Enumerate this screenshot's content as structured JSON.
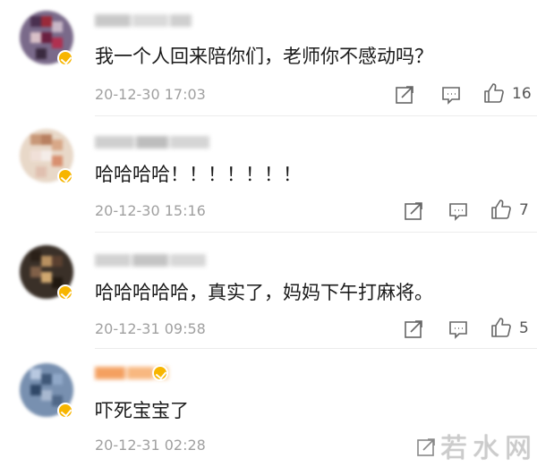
{
  "comments": [
    {
      "text": "我一个人回来陪你们，老师你不感动吗？",
      "time": "20-12-30 17:03",
      "likes": "16"
    },
    {
      "text": "哈哈哈哈！！！！！！！",
      "time": "20-12-30 15:16",
      "likes": "7"
    },
    {
      "text": "哈哈哈哈哈，真实了，妈妈下午打麻将。",
      "time": "20-12-31 09:58",
      "likes": "5"
    },
    {
      "text": "吓死宝宝了",
      "time": "20-12-31 02:28",
      "likes": ""
    }
  ],
  "icons": {
    "share": "share-icon",
    "comment": "comment-icon",
    "like": "thumbs-up-icon",
    "badge": "verified-badge-icon"
  },
  "watermark": {
    "text": "若水网"
  },
  "colors": {
    "badge": "#f7b500",
    "time": "#a0a0a0",
    "text": "#1a1a1a"
  }
}
